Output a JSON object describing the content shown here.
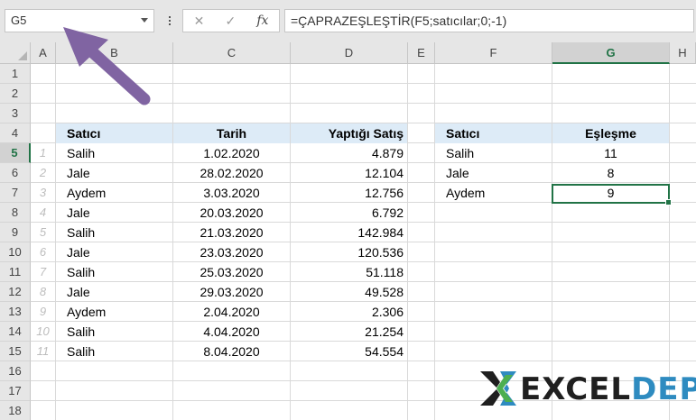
{
  "formula_bar": {
    "name_box": "G5",
    "cancel_icon": "✕",
    "enter_icon": "✓",
    "fx_label": "fx",
    "formula": "=ÇAPRAZEŞLEŞTİR(F5;satıcılar;0;-1)"
  },
  "columns": [
    "A",
    "B",
    "C",
    "D",
    "E",
    "F",
    "G",
    "H"
  ],
  "rows": [
    "1",
    "2",
    "3",
    "4",
    "5",
    "6",
    "7",
    "8",
    "9",
    "10",
    "11",
    "12",
    "13",
    "14",
    "15",
    "16",
    "17",
    "18"
  ],
  "selected_cell": "G5",
  "sales_table": {
    "headers": [
      "Satıcı",
      "Tarih",
      "Yaptığı Satış"
    ],
    "rows": [
      {
        "index": "1",
        "seller": "Salih",
        "date": "1.02.2020",
        "amount": "4.879"
      },
      {
        "index": "2",
        "seller": "Jale",
        "date": "28.02.2020",
        "amount": "12.104"
      },
      {
        "index": "3",
        "seller": "Aydem",
        "date": "3.03.2020",
        "amount": "12.756"
      },
      {
        "index": "4",
        "seller": "Jale",
        "date": "20.03.2020",
        "amount": "6.792"
      },
      {
        "index": "5",
        "seller": "Salih",
        "date": "21.03.2020",
        "amount": "142.984"
      },
      {
        "index": "6",
        "seller": "Jale",
        "date": "23.03.2020",
        "amount": "120.536"
      },
      {
        "index": "7",
        "seller": "Salih",
        "date": "25.03.2020",
        "amount": "51.118"
      },
      {
        "index": "8",
        "seller": "Jale",
        "date": "29.03.2020",
        "amount": "49.528"
      },
      {
        "index": "9",
        "seller": "Aydem",
        "date": "2.04.2020",
        "amount": "2.306"
      },
      {
        "index": "10",
        "seller": "Salih",
        "date": "4.04.2020",
        "amount": "21.254"
      },
      {
        "index": "11",
        "seller": "Salih",
        "date": "8.04.2020",
        "amount": "54.554"
      }
    ]
  },
  "match_table": {
    "headers": [
      "Satıcı",
      "Eşleşme"
    ],
    "rows": [
      {
        "seller": "Salih",
        "match": "11"
      },
      {
        "seller": "Jale",
        "match": "8"
      },
      {
        "seller": "Aydem",
        "match": "9"
      }
    ]
  },
  "logo": {
    "text_excel": "EXCEL",
    "text_depo": "DEPO",
    "color_dark": "#1f1f1f",
    "color_green": "#4caf50",
    "color_teal": "#2e8bc0"
  },
  "colors": {
    "selection": "#217346",
    "header_fill": "#ddebf7",
    "pointer_arrow": "#8064a2"
  }
}
